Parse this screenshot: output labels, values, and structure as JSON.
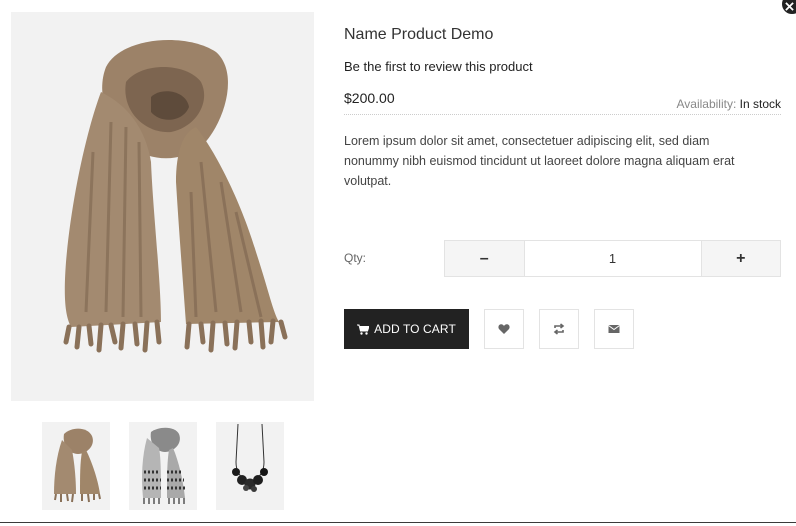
{
  "product": {
    "title": "Name Product Demo",
    "review_link": "Be the first to review this product",
    "price": "$200.00",
    "availability_label": "Availability:",
    "availability_value": "In stock",
    "description": "Lorem ipsum dolor sit amet, consectetuer adipiscing elit, sed diam nonummy nibh euismod tincidunt ut laoreet dolore magna aliquam erat volutpat."
  },
  "quantity": {
    "label": "Qty:",
    "value": "1",
    "decrement": "–",
    "increment": "+"
  },
  "actions": {
    "add_to_cart": "ADD TO CART"
  },
  "thumbnails": [
    "scarf-beige",
    "scarf-patterned-grey",
    "necklace-black-beads"
  ],
  "colors": {
    "primary_button": "#222222",
    "image_background": "#f2f2f2",
    "border": "#e3e3e3"
  }
}
